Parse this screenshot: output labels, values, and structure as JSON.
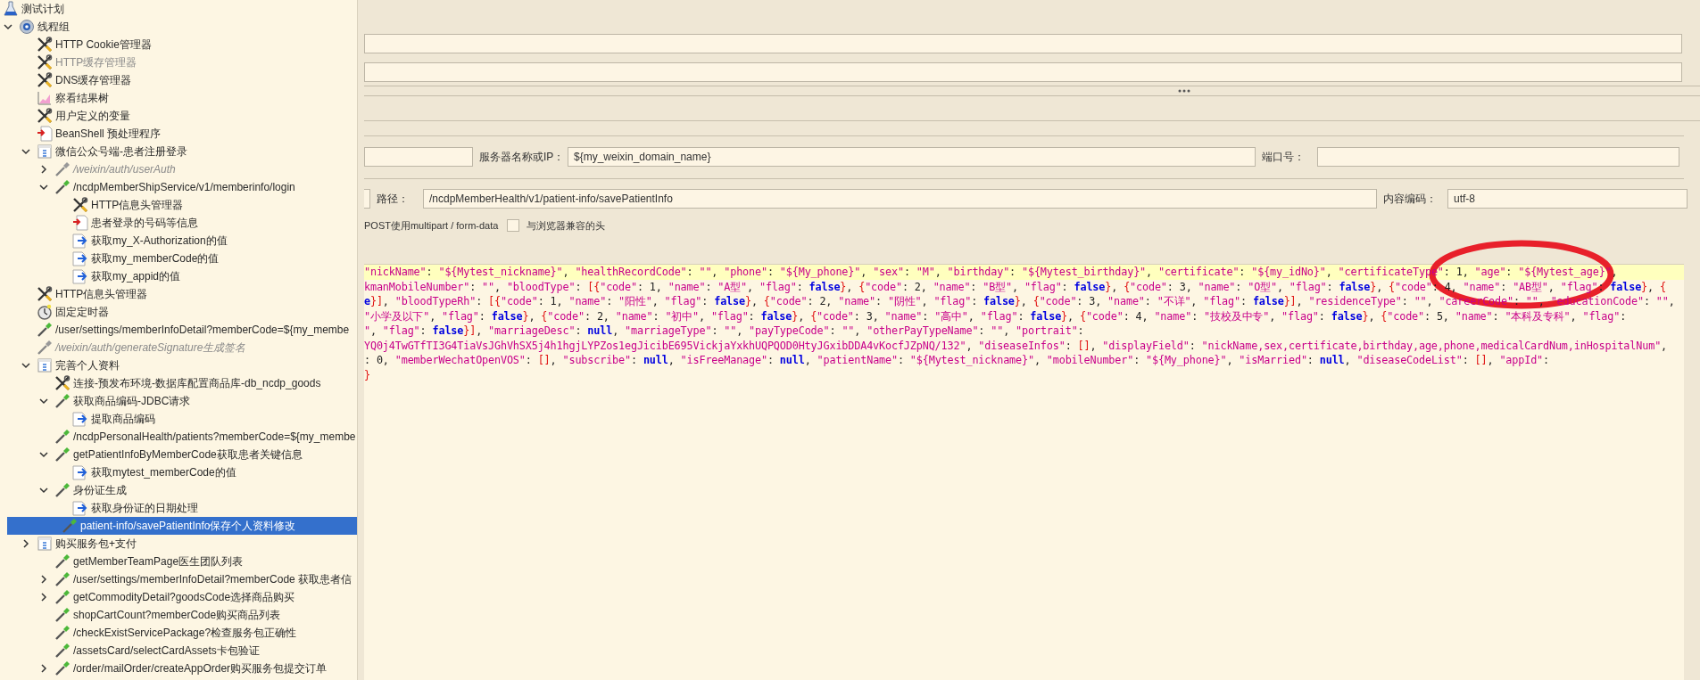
{
  "tree": [
    {
      "label": "测试计划",
      "kind": "plan",
      "children": [
        {
          "label": "线程组",
          "kind": "threadgroup",
          "expanded": true,
          "children": [
            {
              "label": "HTTP Cookie管理器",
              "kind": "config",
              "disabled": false
            },
            {
              "label": "HTTP缓存管理器",
              "kind": "config",
              "disabled": true
            },
            {
              "label": "DNS缓存管理器",
              "kind": "config",
              "disabled": false
            },
            {
              "label": "察看结果树",
              "kind": "listener",
              "disabled": false
            },
            {
              "label": "用户定义的变量",
              "kind": "config",
              "disabled": false
            },
            {
              "label": "BeanShell 预处理程序",
              "kind": "preprocessor",
              "disabled": false
            },
            {
              "label": "微信公众号端-患者注册登录",
              "kind": "controller",
              "expanded": true,
              "disabled": false,
              "children": [
                {
                  "label": "/weixin/auth/userAuth",
                  "kind": "sampler",
                  "expanded": false,
                  "disabled": true
                },
                {
                  "label": "/ncdpMemberShipService/v1/memberinfo/login",
                  "kind": "sampler",
                  "expanded": true,
                  "disabled": false,
                  "children": [
                    {
                      "label": "HTTP信息头管理器",
                      "kind": "config",
                      "disabled": false
                    },
                    {
                      "label": "患者登录的号码等信息",
                      "kind": "preprocessor",
                      "disabled": false
                    },
                    {
                      "label": "获取my_X-Authorization的值",
                      "kind": "extractor",
                      "disabled": false
                    },
                    {
                      "label": "获取my_memberCode的值",
                      "kind": "extractor",
                      "disabled": false
                    },
                    {
                      "label": "获取my_appid的值",
                      "kind": "extractor",
                      "disabled": false
                    }
                  ]
                }
              ]
            },
            {
              "label": "HTTP信息头管理器",
              "kind": "config",
              "disabled": false
            },
            {
              "label": "固定定时器",
              "kind": "timer",
              "disabled": false
            },
            {
              "label": "/user/settings/memberInfoDetail?memberCode=${my_membe",
              "kind": "sampler",
              "disabled": false
            },
            {
              "label": "/weixin/auth/generateSignature生成签名",
              "kind": "sampler",
              "disabled": true
            },
            {
              "label": "完善个人资料",
              "kind": "controller",
              "expanded": true,
              "disabled": false,
              "children": [
                {
                  "label": "连接-预发布环境-数据库配置商品库-db_ncdp_goods",
                  "kind": "config",
                  "disabled": false
                },
                {
                  "label": "获取商品编码-JDBC请求",
                  "kind": "sampler",
                  "expanded": true,
                  "disabled": false,
                  "children": [
                    {
                      "label": "提取商品编码",
                      "kind": "extractor",
                      "disabled": false
                    }
                  ]
                },
                {
                  "label": "/ncdpPersonalHealth/patients?memberCode=${my_membe",
                  "kind": "sampler",
                  "disabled": false
                },
                {
                  "label": "getPatientInfoByMemberCode获取患者关键信息",
                  "kind": "sampler",
                  "expanded": true,
                  "disabled": false,
                  "children": [
                    {
                      "label": "获取mytest_memberCode的值",
                      "kind": "extractor",
                      "disabled": false
                    }
                  ]
                },
                {
                  "label": "身份证生成",
                  "kind": "sampler",
                  "expanded": true,
                  "disabled": false,
                  "children": [
                    {
                      "label": "获取身份证的日期处理",
                      "kind": "extractor",
                      "disabled": false
                    }
                  ]
                },
                {
                  "label": "patient-info/savePatientInfo保存个人资料修改",
                  "kind": "sampler",
                  "disabled": false,
                  "selected": true
                }
              ]
            },
            {
              "label": "购买服务包+支付",
              "kind": "controller",
              "expanded": false,
              "disabled": false,
              "children": [
                {
                  "label": "getMemberTeamPage医生团队列表",
                  "kind": "sampler",
                  "disabled": false
                },
                {
                  "label": "/user/settings/memberInfoDetail?memberCode 获取患者信",
                  "kind": "sampler",
                  "expanded": false,
                  "disabled": false
                },
                {
                  "label": "getCommodityDetail?goodsCode选择商品购买",
                  "kind": "sampler",
                  "expanded": false,
                  "disabled": false
                },
                {
                  "label": "shopCartCount?memberCode购买商品列表",
                  "kind": "sampler",
                  "disabled": false
                },
                {
                  "label": "/checkExistServicePackage?检查服务包正确性",
                  "kind": "sampler",
                  "disabled": false
                },
                {
                  "label": "/assetsCard/selectCardAssets卡包验证",
                  "kind": "sampler",
                  "disabled": false
                },
                {
                  "label": "/order/mailOrder/createAppOrder购买服务包提交订单",
                  "kind": "sampler",
                  "expanded": false,
                  "disabled": false
                }
              ]
            }
          ]
        }
      ]
    }
  ],
  "form": {
    "server_label": "服务器名称或IP：",
    "server_value": "${my_weixin_domain_name}",
    "port_label": "端口号：",
    "path_label": "路径：",
    "path_value": "/ncdpMemberHealth/v1/patient-info/savePatientInfo",
    "encoding_label": "内容编码：",
    "encoding_value": "utf-8",
    "options": [
      {
        "kind": "text",
        "label": "POST使用multipart / form-data"
      },
      {
        "kind": "checkbox",
        "label": "与浏览器兼容的头",
        "checked": false
      }
    ]
  },
  "body_lines": [
    {
      "text": "\"nickName\": \"${Mytest_nickname}\", \"healthRecordCode\": \"\", \"phone\": \"${My_phone}\", \"sex\": \"M\", \"birthday\": \"${Mytest_birthday}\", \"certificate\": \"${my_idNo}\", \"certificateType\": 1, \"age\": \"${Mytest_age}\",",
      "kind": "plain",
      "selected": true
    },
    {
      "text": "kmanMobileNumber\": \"\", \"bloodType\": [{\"code\": 1, \"name\": \"A型\", \"flag\": false}, {\"code\": 2, \"name\": \"B型\", \"flag\": false}, {\"code\": 3, \"name\": \"O型\", \"flag\": false}, {\"code\": 4, \"name\": \"AB型\", \"flag\": false}, {",
      "kind": "continued",
      "selected": false
    },
    {
      "text": "e}], \"bloodTypeRh\": [{\"code\": 1, \"name\": \"阳性\", \"flag\": false}, {\"code\": 2, \"name\": \"阴性\", \"flag\": false}, {\"code\": 3, \"name\": \"不详\", \"flag\": false}], \"residenceType\": \"\", \"careerCode\": \"\", \"educationCode\": \"\",",
      "kind": "plain",
      "selected": false
    },
    {
      "text": "\"小学及以下\", \"flag\": false}, {\"code\": 2, \"name\": \"初中\", \"flag\": false}, {\"code\": 3, \"name\": \"高中\", \"flag\": false}, {\"code\": 4, \"name\": \"技校及中专\", \"flag\": false}, {\"code\": 5, \"name\": \"本科及专科\", \"flag\":",
      "kind": "plain",
      "selected": false
    },
    {
      "text": "\", \"flag\": false}], \"marriageDesc\": null, \"marriageType\": \"\", \"payTypeCode\": \"\", \"otherPayTypeName\": \"\", \"portrait\":",
      "kind": "continued",
      "selected": false
    },
    {
      "text": "YQ0j4TwGTfTI3G4TiaVsJGhVhSX5j4h1hgjLYPZos1egJicibE695VickjaYxkhUQPQOD0HtyJGxibDDA4vKocfJZpNQ/132\", \"diseaseInfos\": [], \"displayField\": \"nickName,sex,certificate,birthday,age,phone,medicalCardNum,inHospitalNum\",",
      "kind": "continued",
      "selected": false
    },
    {
      "text": ": 0, \"memberWechatOpenVOS\": [], \"subscribe\": null, \"isFreeManage\": null, \"patientName\": \"${Mytest_nickname}\", \"mobileNumber\": \"${My_phone}\", \"isMarried\": null, \"diseaseCodeList\": [], \"appId\":",
      "kind": "plain",
      "selected": false
    },
    {
      "text": "}",
      "kind": "plain",
      "selected": false
    }
  ]
}
